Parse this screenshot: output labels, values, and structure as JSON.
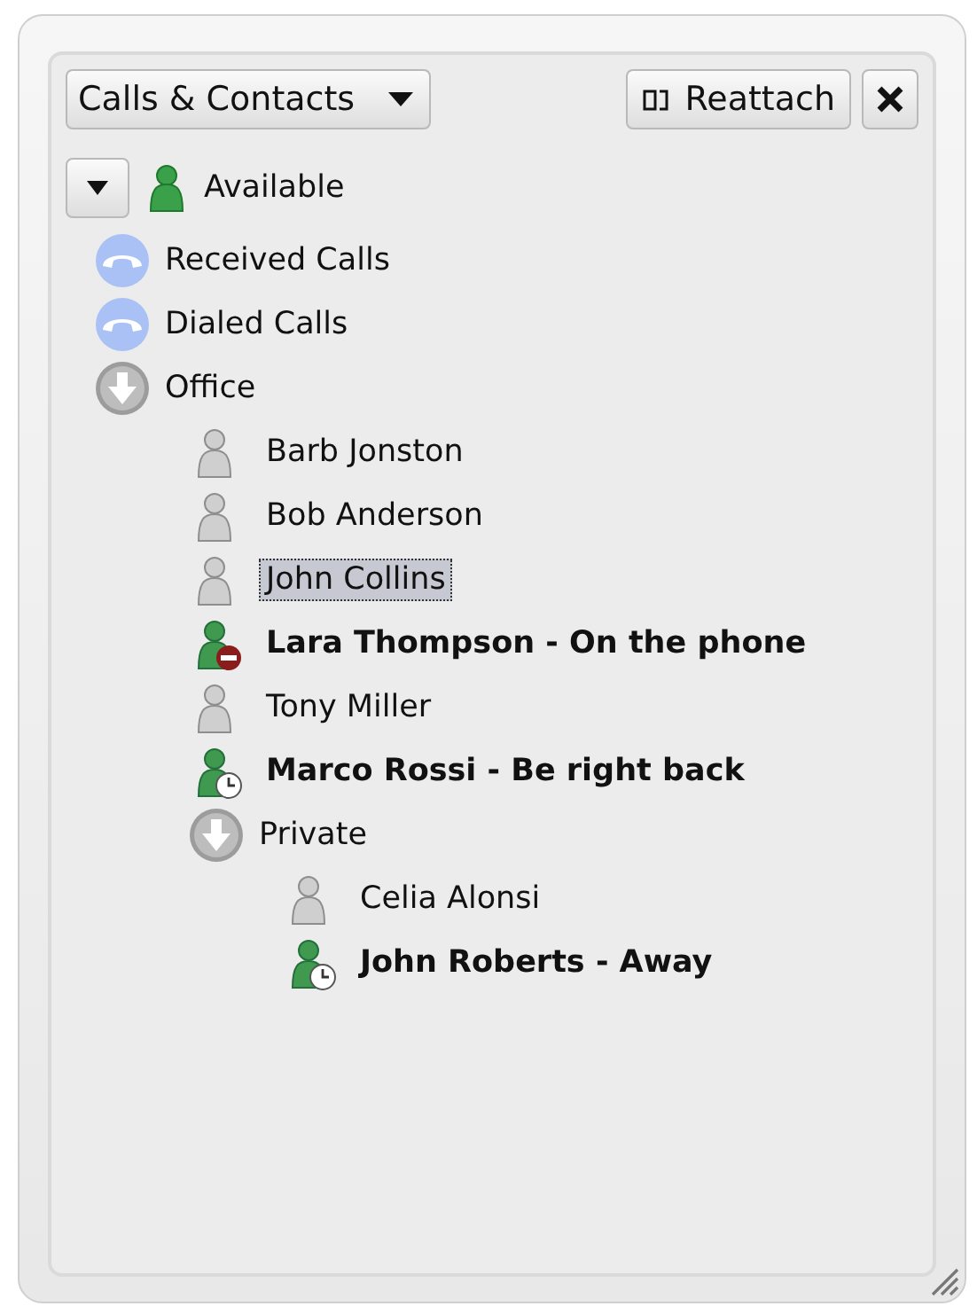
{
  "toolbar": {
    "view_dropdown": "Calls & Contacts",
    "reattach_button": "Reattach"
  },
  "presence": {
    "expanded": true,
    "label": "Available",
    "online": true
  },
  "tree": [
    {
      "kind": "calls",
      "label": "Received Calls"
    },
    {
      "kind": "calls",
      "label": "Dialed Calls"
    },
    {
      "kind": "group",
      "label": "Office",
      "expanded": true,
      "children": [
        {
          "kind": "offline",
          "label": "Barb Jonston",
          "selected": false
        },
        {
          "kind": "offline",
          "label": "Bob Anderson",
          "selected": false
        },
        {
          "kind": "offline",
          "label": "John Collins",
          "selected": true
        },
        {
          "kind": "busy",
          "label": "Lara Thompson - On the phone",
          "selected": false
        },
        {
          "kind": "offline",
          "label": "Tony Miller",
          "selected": false
        },
        {
          "kind": "away",
          "label": "Marco Rossi - Be right back",
          "selected": false
        },
        {
          "kind": "group",
          "label": "Private",
          "expanded": true,
          "children": [
            {
              "kind": "offline",
              "label": "Celia Alonsi",
              "selected": false
            },
            {
              "kind": "away",
              "label": "John Roberts - Away",
              "selected": false
            }
          ]
        }
      ]
    }
  ]
}
